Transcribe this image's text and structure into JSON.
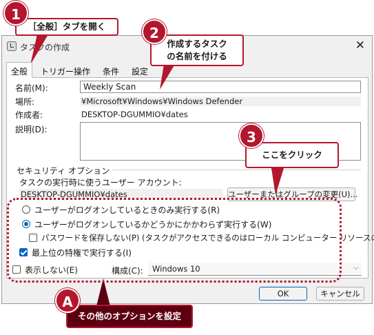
{
  "window": {
    "title": "タスクの作成"
  },
  "tabs": [
    {
      "label": "全般"
    },
    {
      "label": "トリガー"
    },
    {
      "label": "操作"
    },
    {
      "label": "条件"
    },
    {
      "label": "設定"
    }
  ],
  "general": {
    "name_label": "名前(M):",
    "name_value": "Weekly Scan",
    "location_label": "場所:",
    "location_value": "¥Microsoft¥Windows¥Windows Defender",
    "author_label": "作成者:",
    "author_value": "DESKTOP-DGUMMIO¥dates",
    "description_label": "説明(D):"
  },
  "security": {
    "group_label": "セキュリティ オプション",
    "account_prompt": "タスクの実行時に使うユーザー アカウント:",
    "account_value": "DESKTOP-DGUMMIO¥dates",
    "change_button": "ユーザーまたはグループの変更(U)...",
    "radio_logged_on": "ユーザーがログオンしているときのみ実行する(R)",
    "radio_whether": "ユーザーがログオンしているかどうかにかかわらず実行する(W)",
    "no_store_password": "パスワードを保存しない(P) (タスクがアクセスできるのはローカル コンピューター リソースのみ)",
    "highest_privileges": "最上位の特権で実行する(I)"
  },
  "bottom": {
    "hidden_label": "表示しない(E)",
    "configure_label": "構成(C):",
    "configure_value": "Windows 10",
    "ok_button": "OK",
    "cancel_button": "キャンセル"
  },
  "state": {
    "radio_logged_on": false,
    "radio_whether": true,
    "no_store_password": false,
    "highest_privileges": true,
    "hidden": false
  },
  "annotations": {
    "badge_1": "1",
    "callout_1": "［全般］タブを開く",
    "badge_2": "2",
    "callout_2_line1": "作成するタスク",
    "callout_2_line2": "の名前を付ける",
    "badge_3": "3",
    "callout_3": "ここをクリック",
    "badge_a": "A",
    "callout_a": "その他のオプションを設定"
  },
  "colors": {
    "accent": "#0067c0",
    "annotation_red": "#b3172d",
    "annotation_dark": "#5c0011"
  }
}
